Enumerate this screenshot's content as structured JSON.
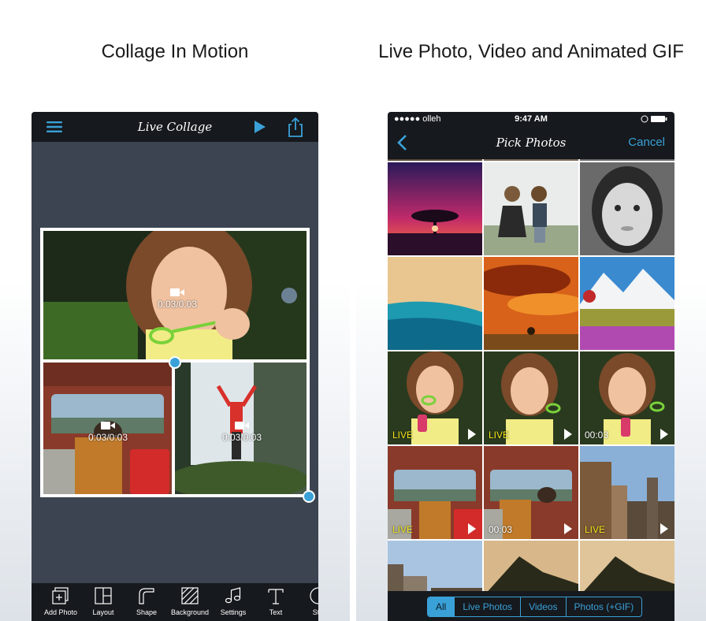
{
  "captions": {
    "left": "Collage In Motion",
    "right": "Live Photo, Video and Animated GIF"
  },
  "colors": {
    "accent": "#3aa1d8",
    "live_badge": "#f4e51a",
    "bar": "#16191d",
    "canvas": "#3b4450"
  },
  "left_app": {
    "title": "Live Collage",
    "icons": {
      "menu": "hamburger-menu-icon",
      "play": "play-icon",
      "share": "share-icon"
    },
    "cells": [
      {
        "timecode": "0:03/0:03",
        "icon": "video-camera-icon"
      },
      {
        "timecode": "0:03/0:03",
        "icon": "video-camera-icon"
      },
      {
        "timecode": "0:03/0:03",
        "icon": "video-camera-icon"
      }
    ],
    "toolbar": [
      {
        "label": "Add Photo",
        "icon": "add-photo-icon"
      },
      {
        "label": "Layout",
        "icon": "layout-icon"
      },
      {
        "label": "Shape",
        "icon": "shape-icon"
      },
      {
        "label": "Background",
        "icon": "background-icon"
      },
      {
        "label": "Settings",
        "icon": "music-note-icon"
      },
      {
        "label": "Text",
        "icon": "text-icon"
      },
      {
        "label": "Sti",
        "icon": "sticker-icon"
      }
    ]
  },
  "right_app": {
    "status": {
      "carrier": "●●●●● olleh",
      "time": "9:47 AM"
    },
    "title": "Pick Photos",
    "cancel": "Cancel",
    "badges": {
      "r3c1": "LIVE",
      "r3c2": "LIVE",
      "r3c3": "00:03",
      "r4c1": "LIVE",
      "r4c2": "00:03",
      "r4c3": "LIVE"
    },
    "filters": [
      "All",
      "Live Photos",
      "Videos",
      "Photos (+GIF)"
    ],
    "active_filter": "All"
  }
}
